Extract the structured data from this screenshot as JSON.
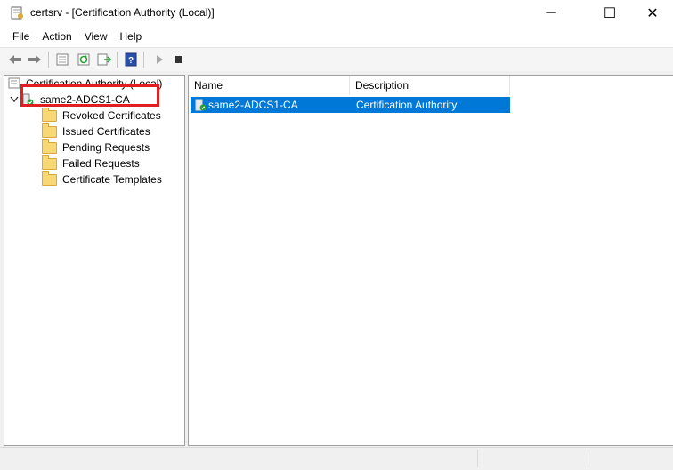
{
  "window": {
    "title": "certsrv - [Certification Authority (Local)]",
    "icon": "certsrv-app-icon",
    "controls": {
      "minimize": "─",
      "maximize": "☐",
      "close": "✕"
    }
  },
  "menu": {
    "items": [
      "File",
      "Action",
      "View",
      "Help"
    ]
  },
  "toolbar": {
    "icons": [
      "back-arrow-icon",
      "forward-arrow-icon",
      "show-hide-console-tree-icon",
      "refresh-icon",
      "export-list-icon",
      "help-icon",
      "start-service-icon",
      "stop-service-icon"
    ]
  },
  "tree": {
    "root": "Certification Authority (Local)",
    "ca_node": "same2-ADCS1-CA",
    "children": [
      "Revoked Certificates",
      "Issued Certificates",
      "Pending Requests",
      "Failed Requests",
      "Certificate Templates"
    ]
  },
  "list": {
    "columns": [
      "Name",
      "Description"
    ],
    "rows": [
      {
        "name": "same2-ADCS1-CA",
        "description": "Certification Authority",
        "selected": true
      }
    ]
  },
  "colors": {
    "selection": "#0078d7",
    "highlight_box": "#e02020",
    "folder": "#f8d775"
  }
}
